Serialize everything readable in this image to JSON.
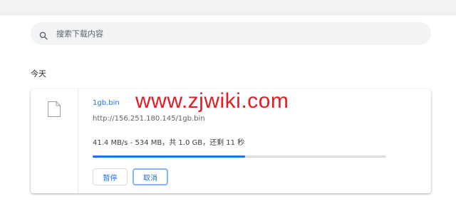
{
  "search": {
    "placeholder": "搜索下载内容"
  },
  "section": {
    "date_label": "今天"
  },
  "download": {
    "file_name": "1gb.bin",
    "url": "http://156.251.180.145/1gb.bin",
    "watermark": "www.zjwiki.com",
    "status_text": "41.4 MB/s - 534 MB，共 1.0 GB，还剩 11 秒",
    "progress_fraction": 0.52,
    "pause_label": "暂停",
    "cancel_label": "取消"
  },
  "colors": {
    "accent": "#1a73e8",
    "watermark": "#e51c23",
    "search_bg": "#f1f3f4"
  },
  "icons": {
    "search": "search-icon",
    "file": "file-icon"
  }
}
